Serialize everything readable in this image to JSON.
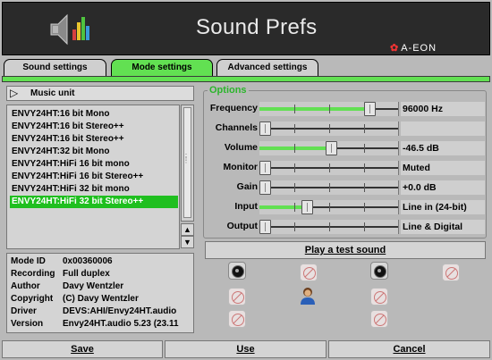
{
  "header": {
    "title": "Sound Prefs",
    "brand": "A-EON",
    "brand_mark": "✿"
  },
  "tabs": [
    {
      "label": "Sound settings",
      "active": false
    },
    {
      "label": "Mode settings",
      "active": true
    },
    {
      "label": "Advanced settings",
      "active": false
    }
  ],
  "unit": {
    "label": "Music unit",
    "icon": "play-triangle-icon"
  },
  "modes": [
    "ENVY24HT:16 bit Mono",
    "ENVY24HT:16 bit Stereo++",
    "ENVY24HT:16 bit Stereo++",
    "ENVY24HT:32 bit Mono",
    "ENVY24HT:HiFi 16 bit mono",
    "ENVY24HT:HiFi 16 bit Stereo++",
    "ENVY24HT:HiFi 32 bit mono",
    "ENVY24HT:HiFi 32 bit Stereo++"
  ],
  "selected_mode_index": 7,
  "info": [
    {
      "key": "Mode ID",
      "value": "0x00360006"
    },
    {
      "key": "Recording",
      "value": "Full duplex"
    },
    {
      "key": "Author",
      "value": "Davy Wentzler"
    },
    {
      "key": "Copyright",
      "value": "(C) Davy Wentzler"
    },
    {
      "key": "Driver",
      "value": "DEVS:AHI/Envy24HT.audio"
    },
    {
      "key": "Version",
      "value": "Envy24HT.audio 5.23 (23.11"
    }
  ],
  "options": {
    "title": "Options",
    "rows": [
      {
        "label": "Frequency",
        "value": "96000 Hz",
        "level": 0.82
      },
      {
        "label": "Channels",
        "value": "",
        "level": 0.0
      },
      {
        "label": "Volume",
        "value": "-46.5 dB",
        "level": 0.52
      },
      {
        "label": "Monitor",
        "value": "Muted",
        "level": 0.0
      },
      {
        "label": "Gain",
        "value": "+0.0 dB",
        "level": 0.0
      },
      {
        "label": "Input",
        "value": "Line in (24-bit)",
        "level": 0.33
      },
      {
        "label": "Output",
        "value": "Line & Digital",
        "level": 0.0
      }
    ]
  },
  "test_sound": "Play a test sound",
  "buttons": {
    "save": "Save",
    "use": "Use",
    "cancel": "Cancel"
  },
  "colors": {
    "accent": "#62e052",
    "selection": "#1fbf1f",
    "options_title": "#2bb52b"
  }
}
